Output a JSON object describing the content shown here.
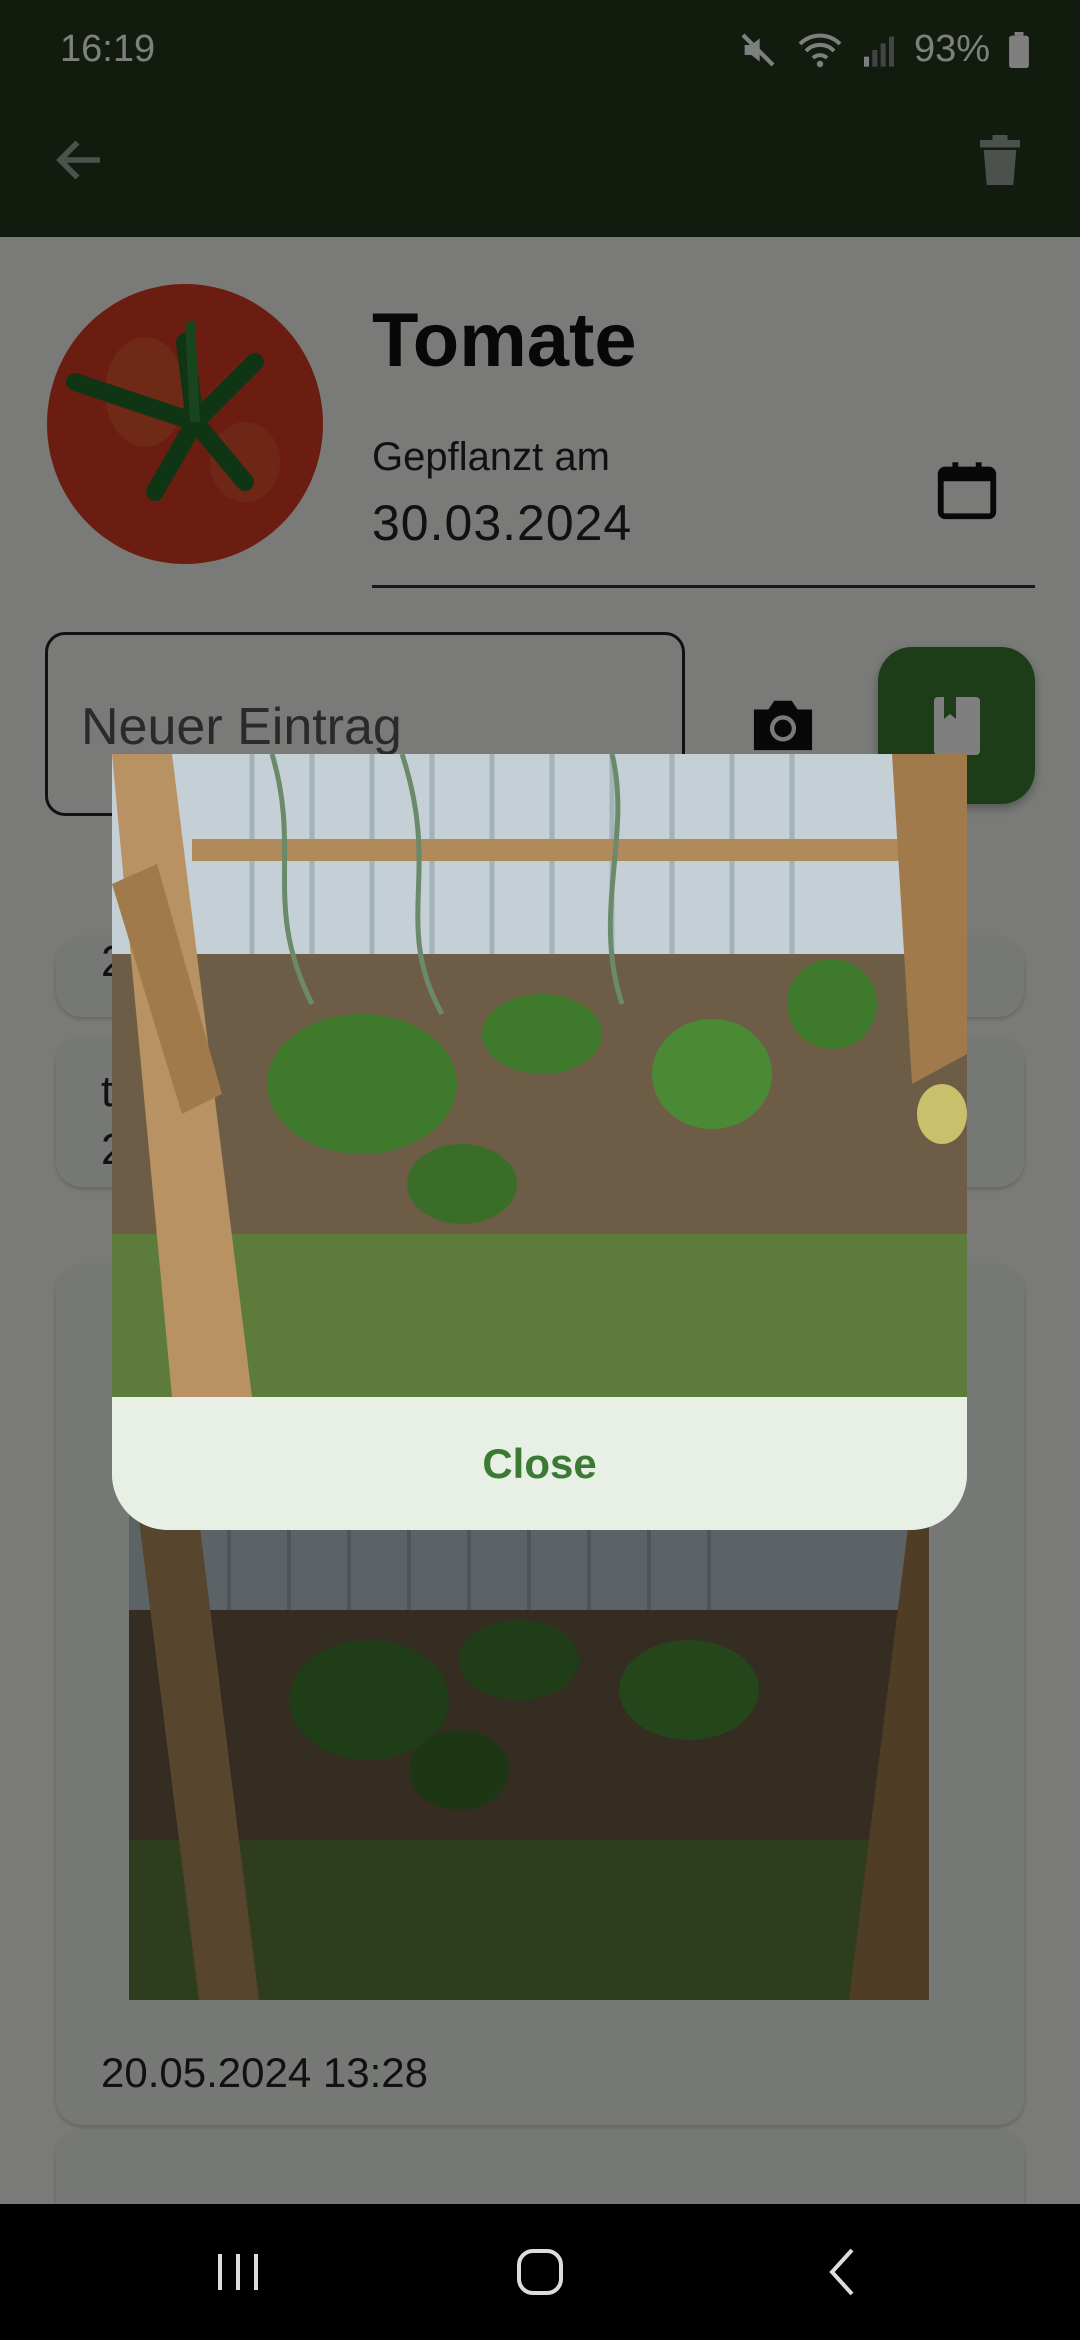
{
  "status_bar": {
    "time": "16:19",
    "battery": "93%"
  },
  "app_bar": {
    "back_icon": "arrow-left-icon",
    "delete_icon": "trash-icon"
  },
  "plant": {
    "name": "Tomate",
    "planted_label": "Gepflanzt am",
    "planted_date": "30.03.2024"
  },
  "new_entry": {
    "placeholder": "Neuer Eintrag"
  },
  "entries": [
    {
      "text": "2",
      "timestamp": ""
    },
    {
      "text": "t",
      "timestamp": "2"
    },
    {
      "text": "",
      "timestamp": "20.05.2024 13:28",
      "has_photo": true
    }
  ],
  "dialog": {
    "close_label": "Close"
  },
  "colors": {
    "app_bar": "#22391e",
    "accent": "#3b7a33",
    "card": "#edf1ea"
  }
}
